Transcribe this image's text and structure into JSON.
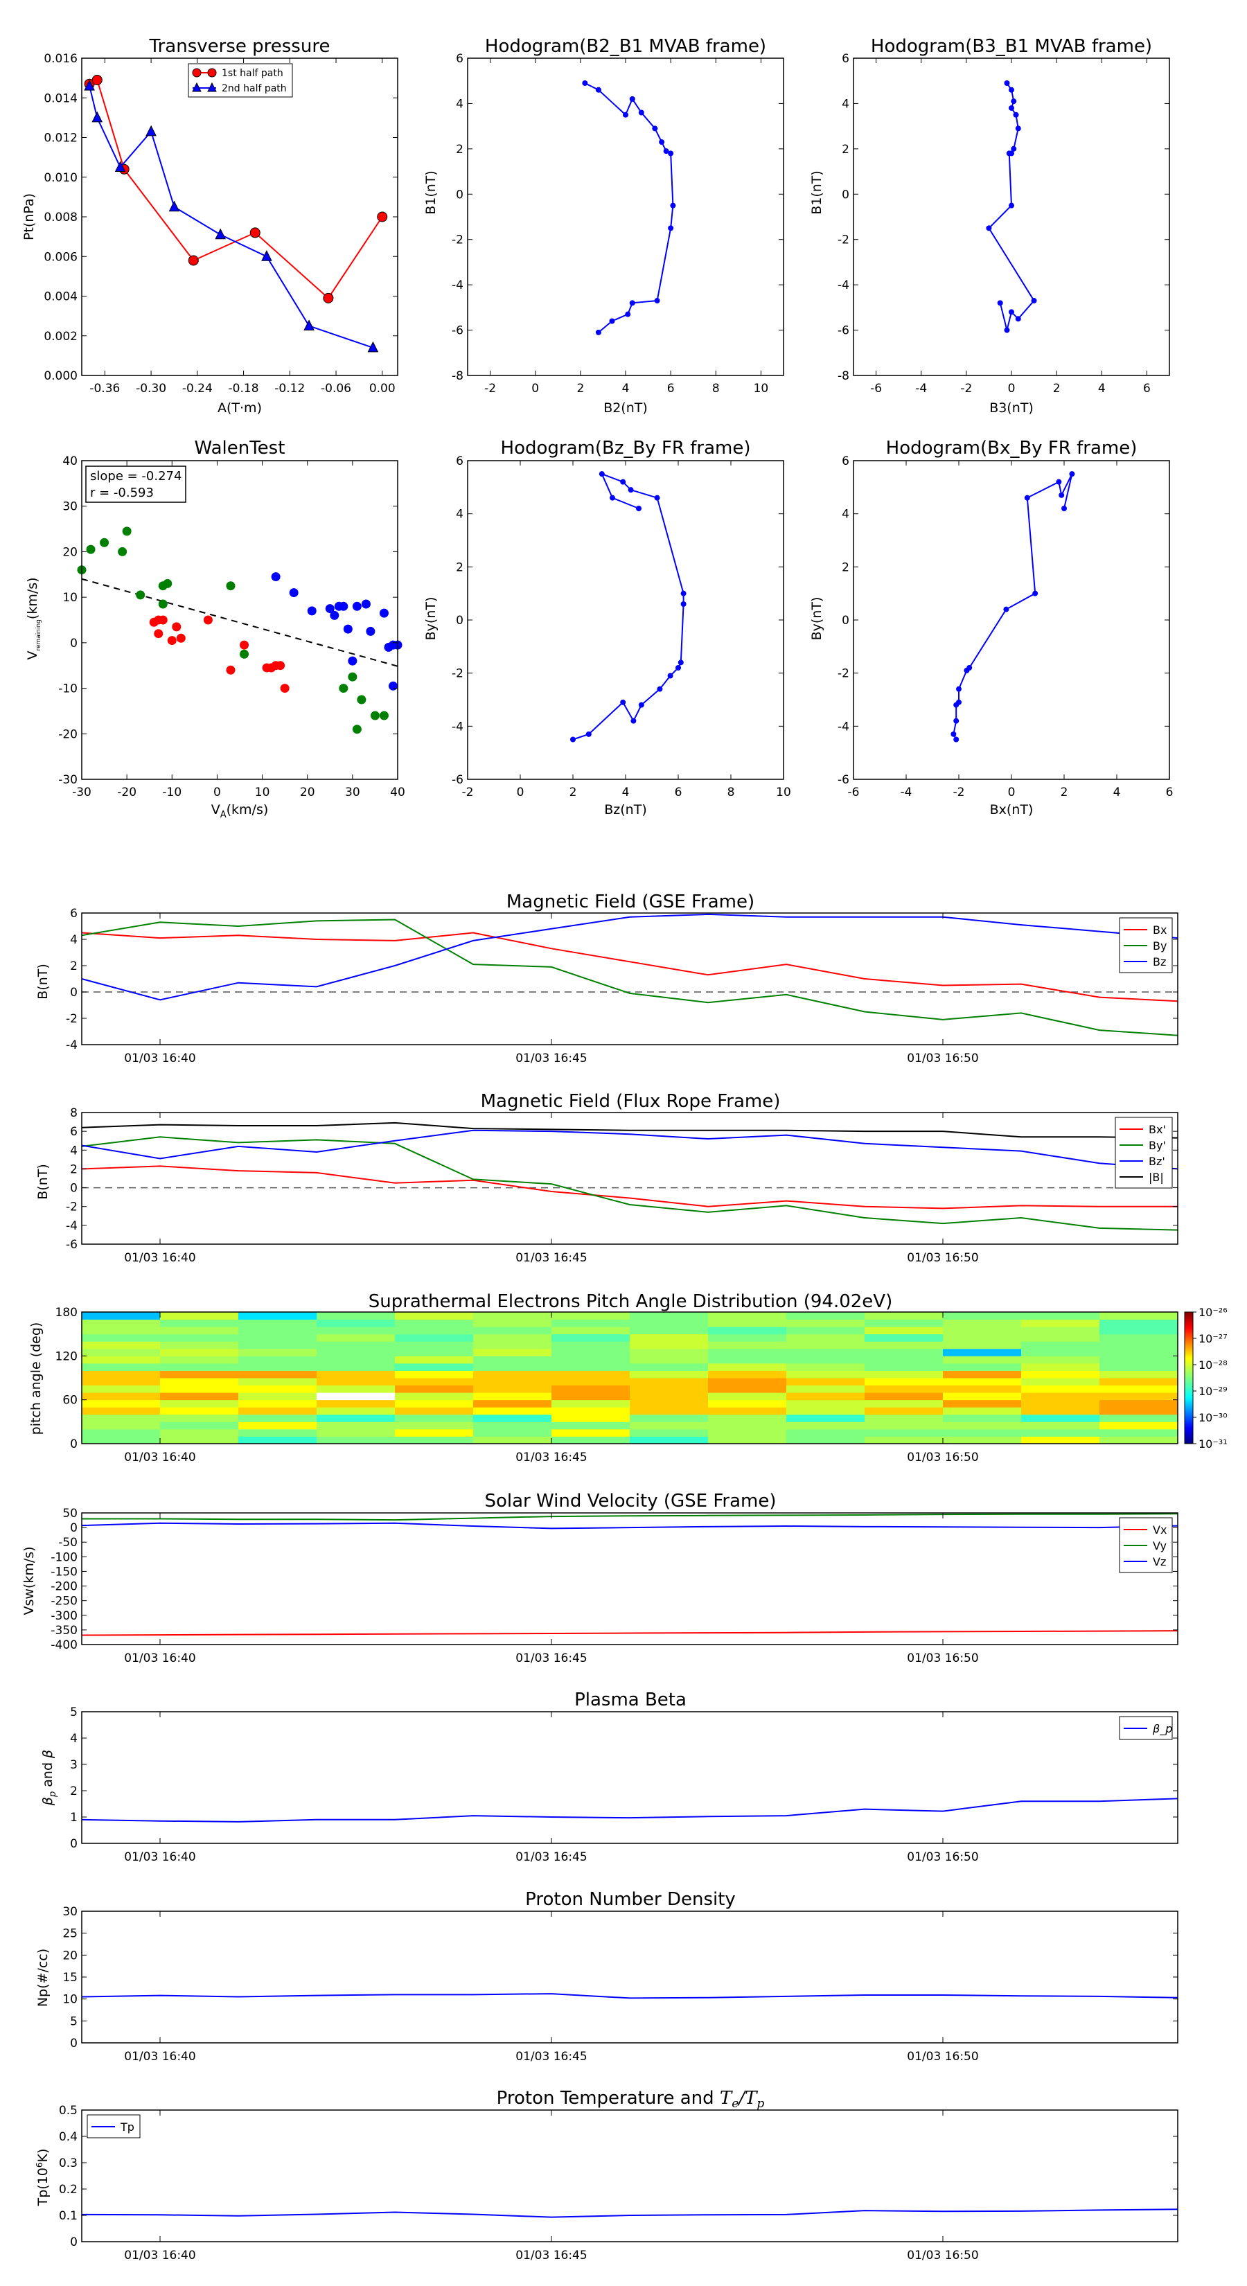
{
  "chart_data": [
    {
      "id": "tp",
      "type": "line",
      "title": "Transverse pressure",
      "xlabel": "A(T·m)",
      "ylabel": "Pt(nPa)",
      "xlim": [
        -0.39,
        0.02
      ],
      "ylim": [
        0,
        0.016
      ],
      "xticks": [
        -0.36,
        -0.3,
        -0.24,
        -0.18,
        -0.12,
        -0.06,
        0.0
      ],
      "xtick_labels": [
        "-0.36",
        "-0.30",
        "-0.24",
        "-0.18",
        "-0.12",
        "-0.06",
        "0.00"
      ],
      "yticks": [
        0,
        0.002,
        0.004,
        0.006,
        0.008,
        0.01,
        0.012,
        0.014,
        0.016
      ],
      "ytick_labels": [
        "0.000",
        "0.002",
        "0.004",
        "0.006",
        "0.008",
        "0.010",
        "0.012",
        "0.014",
        "0.016"
      ],
      "legend": {
        "position": "top-center",
        "entries": [
          "1st half path",
          "2nd half path"
        ]
      },
      "series": [
        {
          "name": "1st half path",
          "color": "#ff0000",
          "marker": "circle",
          "x": [
            -0.38,
            -0.37,
            -0.335,
            -0.245,
            -0.165,
            -0.07,
            0.0
          ],
          "y": [
            0.0147,
            0.0149,
            0.0104,
            0.0058,
            0.0072,
            0.0039,
            0.008
          ]
        },
        {
          "name": "2nd half path",
          "color": "#0000ff",
          "marker": "triangle",
          "x": [
            -0.38,
            -0.37,
            -0.34,
            -0.3,
            -0.27,
            -0.21,
            -0.15,
            -0.095,
            -0.012
          ],
          "y": [
            0.0146,
            0.013,
            0.0105,
            0.0123,
            0.0085,
            0.0071,
            0.006,
            0.0025,
            0.0014
          ]
        }
      ]
    },
    {
      "id": "h1",
      "type": "line",
      "title": "Hodogram(B2_B1 MVAB frame)",
      "xlabel": "B2(nT)",
      "ylabel": "B1(nT)",
      "xlim": [
        -3,
        11
      ],
      "ylim": [
        -8,
        6
      ],
      "xticks": [
        -2,
        0,
        2,
        4,
        6,
        8,
        10
      ],
      "yticks": [
        -8,
        -6,
        -4,
        -2,
        0,
        2,
        4,
        6
      ],
      "series": [
        {
          "color": "#0000ff",
          "x": [
            2.2,
            2.8,
            4.0,
            4.3,
            4.7,
            5.3,
            5.6,
            5.8,
            6.0,
            6.1,
            6.0,
            5.4,
            4.3,
            4.1,
            3.4,
            2.8
          ],
          "y": [
            4.9,
            4.6,
            3.5,
            4.2,
            3.6,
            2.9,
            2.3,
            1.9,
            1.8,
            -0.5,
            -1.5,
            -4.7,
            -4.8,
            -5.3,
            -5.6,
            -6.1
          ]
        }
      ]
    },
    {
      "id": "h2",
      "type": "line",
      "title": "Hodogram(B3_B1 MVAB frame)",
      "xlabel": "B3(nT)",
      "ylabel": "B1(nT)",
      "xlim": [
        -7,
        7
      ],
      "ylim": [
        -8,
        6
      ],
      "xticks": [
        -6,
        -4,
        -2,
        0,
        2,
        4,
        6
      ],
      "yticks": [
        -8,
        -6,
        -4,
        -2,
        0,
        2,
        4,
        6
      ],
      "series": [
        {
          "color": "#0000ff",
          "x": [
            -0.2,
            0.0,
            0.1,
            0.0,
            0.2,
            0.3,
            0.1,
            0.0,
            -0.1,
            0.0,
            -1.0,
            1.0,
            0.3,
            0.0,
            -0.2,
            -0.5
          ],
          "y": [
            4.9,
            4.6,
            4.1,
            3.8,
            3.5,
            2.9,
            2.0,
            1.8,
            1.8,
            -0.5,
            -1.5,
            -4.7,
            -5.5,
            -5.2,
            -6.0,
            -4.8
          ]
        }
      ]
    },
    {
      "id": "walen",
      "type": "scatter",
      "title": "WalenTest",
      "xlabel": "V_A(km/s)",
      "ylabel": "V_remaining(km/s)",
      "xlim": [
        -30,
        40
      ],
      "ylim": [
        -30,
        40
      ],
      "xticks": [
        -30,
        -20,
        -10,
        0,
        10,
        20,
        30,
        40
      ],
      "yticks": [
        -30,
        -20,
        -10,
        0,
        10,
        20,
        30,
        40
      ],
      "annotation": [
        "slope = -0.274",
        "r = -0.593"
      ],
      "fit_line": {
        "slope": -0.274,
        "intercept": 5.8,
        "style": "dashed",
        "color": "#000000"
      },
      "series": [
        {
          "color": "#008000",
          "x": [
            -30,
            -28,
            -25,
            -21,
            -20,
            -17,
            -12,
            -12,
            -11,
            3,
            6,
            28,
            31,
            32,
            35,
            37,
            30
          ],
          "y": [
            16,
            20.5,
            22,
            20,
            24.5,
            10.5,
            8.5,
            12.5,
            13,
            12.5,
            -2.5,
            -10,
            -19,
            -12.5,
            -16,
            -16,
            -7.5
          ]
        },
        {
          "color": "#ff0000",
          "x": [
            -14,
            -13,
            -13,
            -12,
            -10,
            -9,
            -8,
            -2,
            3,
            6,
            11,
            12,
            13,
            14,
            15
          ],
          "y": [
            4.5,
            5,
            2,
            5,
            0.5,
            3.5,
            1,
            5,
            -6,
            -0.5,
            -5.5,
            -5.5,
            -5,
            -5,
            -10
          ]
        },
        {
          "color": "#0000ff",
          "x": [
            13,
            17,
            21,
            25,
            26,
            27,
            28,
            29,
            30,
            31,
            33,
            34,
            37,
            38,
            39,
            39,
            40
          ],
          "y": [
            14.5,
            11,
            7,
            7.5,
            6,
            8,
            8,
            3,
            -4,
            8,
            8.5,
            2.5,
            6.5,
            -1,
            -9.5,
            -0.5,
            -0.5
          ]
        }
      ]
    },
    {
      "id": "h3",
      "type": "line",
      "title": "Hodogram(Bz_By FR frame)",
      "xlabel": "Bz(nT)",
      "ylabel": "By(nT)",
      "xlim": [
        -2,
        10
      ],
      "ylim": [
        -6,
        6
      ],
      "xticks": [
        -2,
        0,
        2,
        4,
        6,
        8,
        10
      ],
      "yticks": [
        -6,
        -4,
        -2,
        0,
        2,
        4,
        6
      ],
      "series": [
        {
          "color": "#0000ff",
          "x": [
            4.5,
            3.5,
            3.1,
            3.9,
            4.2,
            5.2,
            6.2,
            6.2,
            6.1,
            6.0,
            5.7,
            5.3,
            4.6,
            4.3,
            3.9,
            2.6,
            2.0
          ],
          "y": [
            4.2,
            4.6,
            5.5,
            5.2,
            4.9,
            4.6,
            1.0,
            0.6,
            -1.6,
            -1.8,
            -2.1,
            -2.6,
            -3.2,
            -3.8,
            -3.1,
            -4.3,
            -4.5
          ]
        }
      ]
    },
    {
      "id": "h4",
      "type": "line",
      "title": "Hodogram(Bx_By FR frame)",
      "xlabel": "Bx(nT)",
      "ylabel": "By(nT)",
      "xlim": [
        -6,
        6
      ],
      "ylim": [
        -6,
        6
      ],
      "xticks": [
        -6,
        -4,
        -2,
        0,
        2,
        4,
        6
      ],
      "yticks": [
        -6,
        -4,
        -2,
        0,
        2,
        4,
        6
      ],
      "series": [
        {
          "color": "#0000ff",
          "x": [
            2.0,
            2.3,
            1.9,
            1.8,
            0.6,
            0.9,
            -0.2,
            -1.6,
            -1.7,
            -2.0,
            -2.0,
            -2.1,
            -2.1,
            -2.2,
            -2.1
          ],
          "y": [
            4.2,
            5.5,
            4.7,
            5.2,
            4.6,
            1.0,
            0.4,
            -1.8,
            -1.9,
            -2.6,
            -3.1,
            -3.2,
            -3.8,
            -4.3,
            -4.5
          ]
        }
      ]
    },
    {
      "id": "ts1",
      "type": "line",
      "title": "Magnetic Field (GSE Frame)",
      "ylabel": "B(nT)",
      "xlim": [
        0,
        14
      ],
      "ylim": [
        -4,
        6
      ],
      "yticks": [
        -4,
        -2,
        0,
        2,
        4,
        6
      ],
      "zero_line": true,
      "legend": "top-right",
      "series": [
        {
          "name": "Bx",
          "color": "#ff0000",
          "values": [
            4.5,
            4.1,
            4.3,
            4.0,
            3.9,
            4.5,
            3.3,
            2.3,
            1.3,
            2.1,
            1.0,
            0.5,
            0.6,
            -0.4,
            -0.7
          ]
        },
        {
          "name": "By",
          "color": "#008000",
          "values": [
            4.3,
            5.3,
            5.0,
            5.4,
            5.5,
            2.1,
            1.9,
            -0.1,
            -0.8,
            -0.2,
            -1.5,
            -2.1,
            -1.6,
            -2.9,
            -3.3
          ]
        },
        {
          "name": "Bz",
          "color": "#0000ff",
          "values": [
            1.0,
            -0.6,
            0.7,
            0.4,
            2.0,
            3.9,
            4.8,
            5.7,
            5.9,
            5.7,
            5.7,
            5.7,
            5.1,
            4.6,
            4.1
          ]
        }
      ]
    },
    {
      "id": "ts2",
      "type": "line",
      "title": "Magnetic Field (Flux Rope Frame)",
      "ylabel": "B(nT)",
      "xlim": [
        0,
        14
      ],
      "ylim": [
        -6,
        8
      ],
      "yticks": [
        -6,
        -4,
        -2,
        0,
        2,
        4,
        6,
        8
      ],
      "zero_line": true,
      "legend": "top-right",
      "series": [
        {
          "name": "Bx'",
          "color": "#ff0000",
          "values": [
            2.0,
            2.3,
            1.8,
            1.6,
            0.5,
            0.8,
            -0.4,
            -1.1,
            -2.0,
            -1.4,
            -2.0,
            -2.2,
            -1.9,
            -2.0,
            -2.0
          ]
        },
        {
          "name": "By'",
          "color": "#008000",
          "values": [
            4.4,
            5.4,
            4.8,
            5.1,
            4.7,
            0.9,
            0.4,
            -1.8,
            -2.6,
            -1.9,
            -3.2,
            -3.8,
            -3.2,
            -4.3,
            -4.5
          ]
        },
        {
          "name": "Bz'",
          "color": "#0000ff",
          "values": [
            4.5,
            3.1,
            4.4,
            3.8,
            5.0,
            6.1,
            6.0,
            5.7,
            5.2,
            5.6,
            4.7,
            4.3,
            3.9,
            2.6,
            2.0
          ]
        },
        {
          "name": "|B|",
          "color": "#000000",
          "values": [
            6.4,
            6.7,
            6.6,
            6.6,
            6.9,
            6.3,
            6.2,
            6.1,
            6.1,
            6.1,
            6.0,
            6.0,
            5.4,
            5.4,
            5.3
          ]
        }
      ]
    },
    {
      "id": "pad",
      "type": "heatmap",
      "title": "Suprathermal Electrons Pitch Angle Distribution (94.02eV)",
      "ylabel": "pitch angle (deg)",
      "xlim": [
        0,
        14
      ],
      "ylim": [
        0,
        180
      ],
      "yticks": [
        0,
        60,
        120,
        180
      ],
      "colorbar_ticks": [
        "10⁻²⁶",
        "10⁻²⁷",
        "10⁻²⁸",
        "10⁻²⁹",
        "10⁻³⁰",
        "10⁻³¹"
      ],
      "bins": {
        "columns": 14,
        "rows": 18
      }
    },
    {
      "id": "ts3",
      "type": "line",
      "title": "Solar Wind Velocity (GSE Frame)",
      "ylabel": "Vsw(km/s)",
      "xlim": [
        0,
        14
      ],
      "ylim": [
        -400,
        50
      ],
      "yticks": [
        50,
        0,
        -50,
        -100,
        -150,
        -200,
        -250,
        -300,
        -350,
        -400
      ],
      "legend": "top-right",
      "series": [
        {
          "name": "Vx",
          "color": "#ff0000",
          "values": [
            -368,
            -367,
            -366,
            -365,
            -364,
            -363,
            -362,
            -361,
            -360,
            -359,
            -357,
            -356,
            -355,
            -354,
            -353
          ]
        },
        {
          "name": "Vy",
          "color": "#008000",
          "values": [
            30,
            30,
            28,
            28,
            26,
            32,
            38,
            40,
            41,
            42,
            43,
            45,
            46,
            46,
            47
          ]
        },
        {
          "name": "Vz",
          "color": "#0000ff",
          "values": [
            7,
            15,
            12,
            13,
            15,
            5,
            -3,
            0,
            3,
            5,
            3,
            2,
            1,
            0,
            6
          ]
        }
      ]
    },
    {
      "id": "ts4",
      "type": "line",
      "title": "Plasma Beta",
      "ylabel": "β_p and β",
      "xlim": [
        0,
        14
      ],
      "ylim": [
        0,
        5
      ],
      "yticks": [
        0,
        1,
        2,
        3,
        4,
        5
      ],
      "legend": "top-right",
      "series": [
        {
          "name": "β_p",
          "color": "#0000ff",
          "values": [
            0.9,
            0.85,
            0.82,
            0.9,
            0.9,
            1.05,
            1.0,
            0.97,
            1.02,
            1.05,
            1.3,
            1.22,
            1.6,
            1.6,
            1.7
          ]
        }
      ]
    },
    {
      "id": "ts5",
      "type": "line",
      "title": "Proton Number Density",
      "ylabel": "Np(#/cc)",
      "xlim": [
        0,
        14
      ],
      "ylim": [
        0,
        30
      ],
      "yticks": [
        0,
        5,
        10,
        15,
        20,
        25,
        30
      ],
      "series": [
        {
          "color": "#0000ff",
          "values": [
            10.5,
            10.8,
            10.5,
            10.8,
            11.0,
            11.0,
            11.2,
            10.2,
            10.3,
            10.6,
            10.9,
            10.9,
            10.7,
            10.6,
            10.3
          ]
        }
      ]
    },
    {
      "id": "ts6",
      "type": "line",
      "title": "Proton Temperature and T_e/T_p",
      "ylabel": "Tp(10^6K)",
      "xlim": [
        0,
        14
      ],
      "ylim": [
        0,
        0.5
      ],
      "yticks": [
        0,
        0.1,
        0.2,
        0.3,
        0.4,
        0.5
      ],
      "legend": "top-left",
      "series": [
        {
          "name": "Tp",
          "color": "#0000ff",
          "values": [
            0.103,
            0.102,
            0.098,
            0.104,
            0.112,
            0.104,
            0.093,
            0.1,
            0.102,
            0.103,
            0.118,
            0.115,
            0.116,
            0.12,
            0.123
          ]
        }
      ]
    }
  ],
  "time_axis": {
    "ticks": [
      1,
      6,
      11
    ],
    "labels": [
      "01/03 16:40",
      "01/03 16:45",
      "01/03 16:50"
    ]
  }
}
